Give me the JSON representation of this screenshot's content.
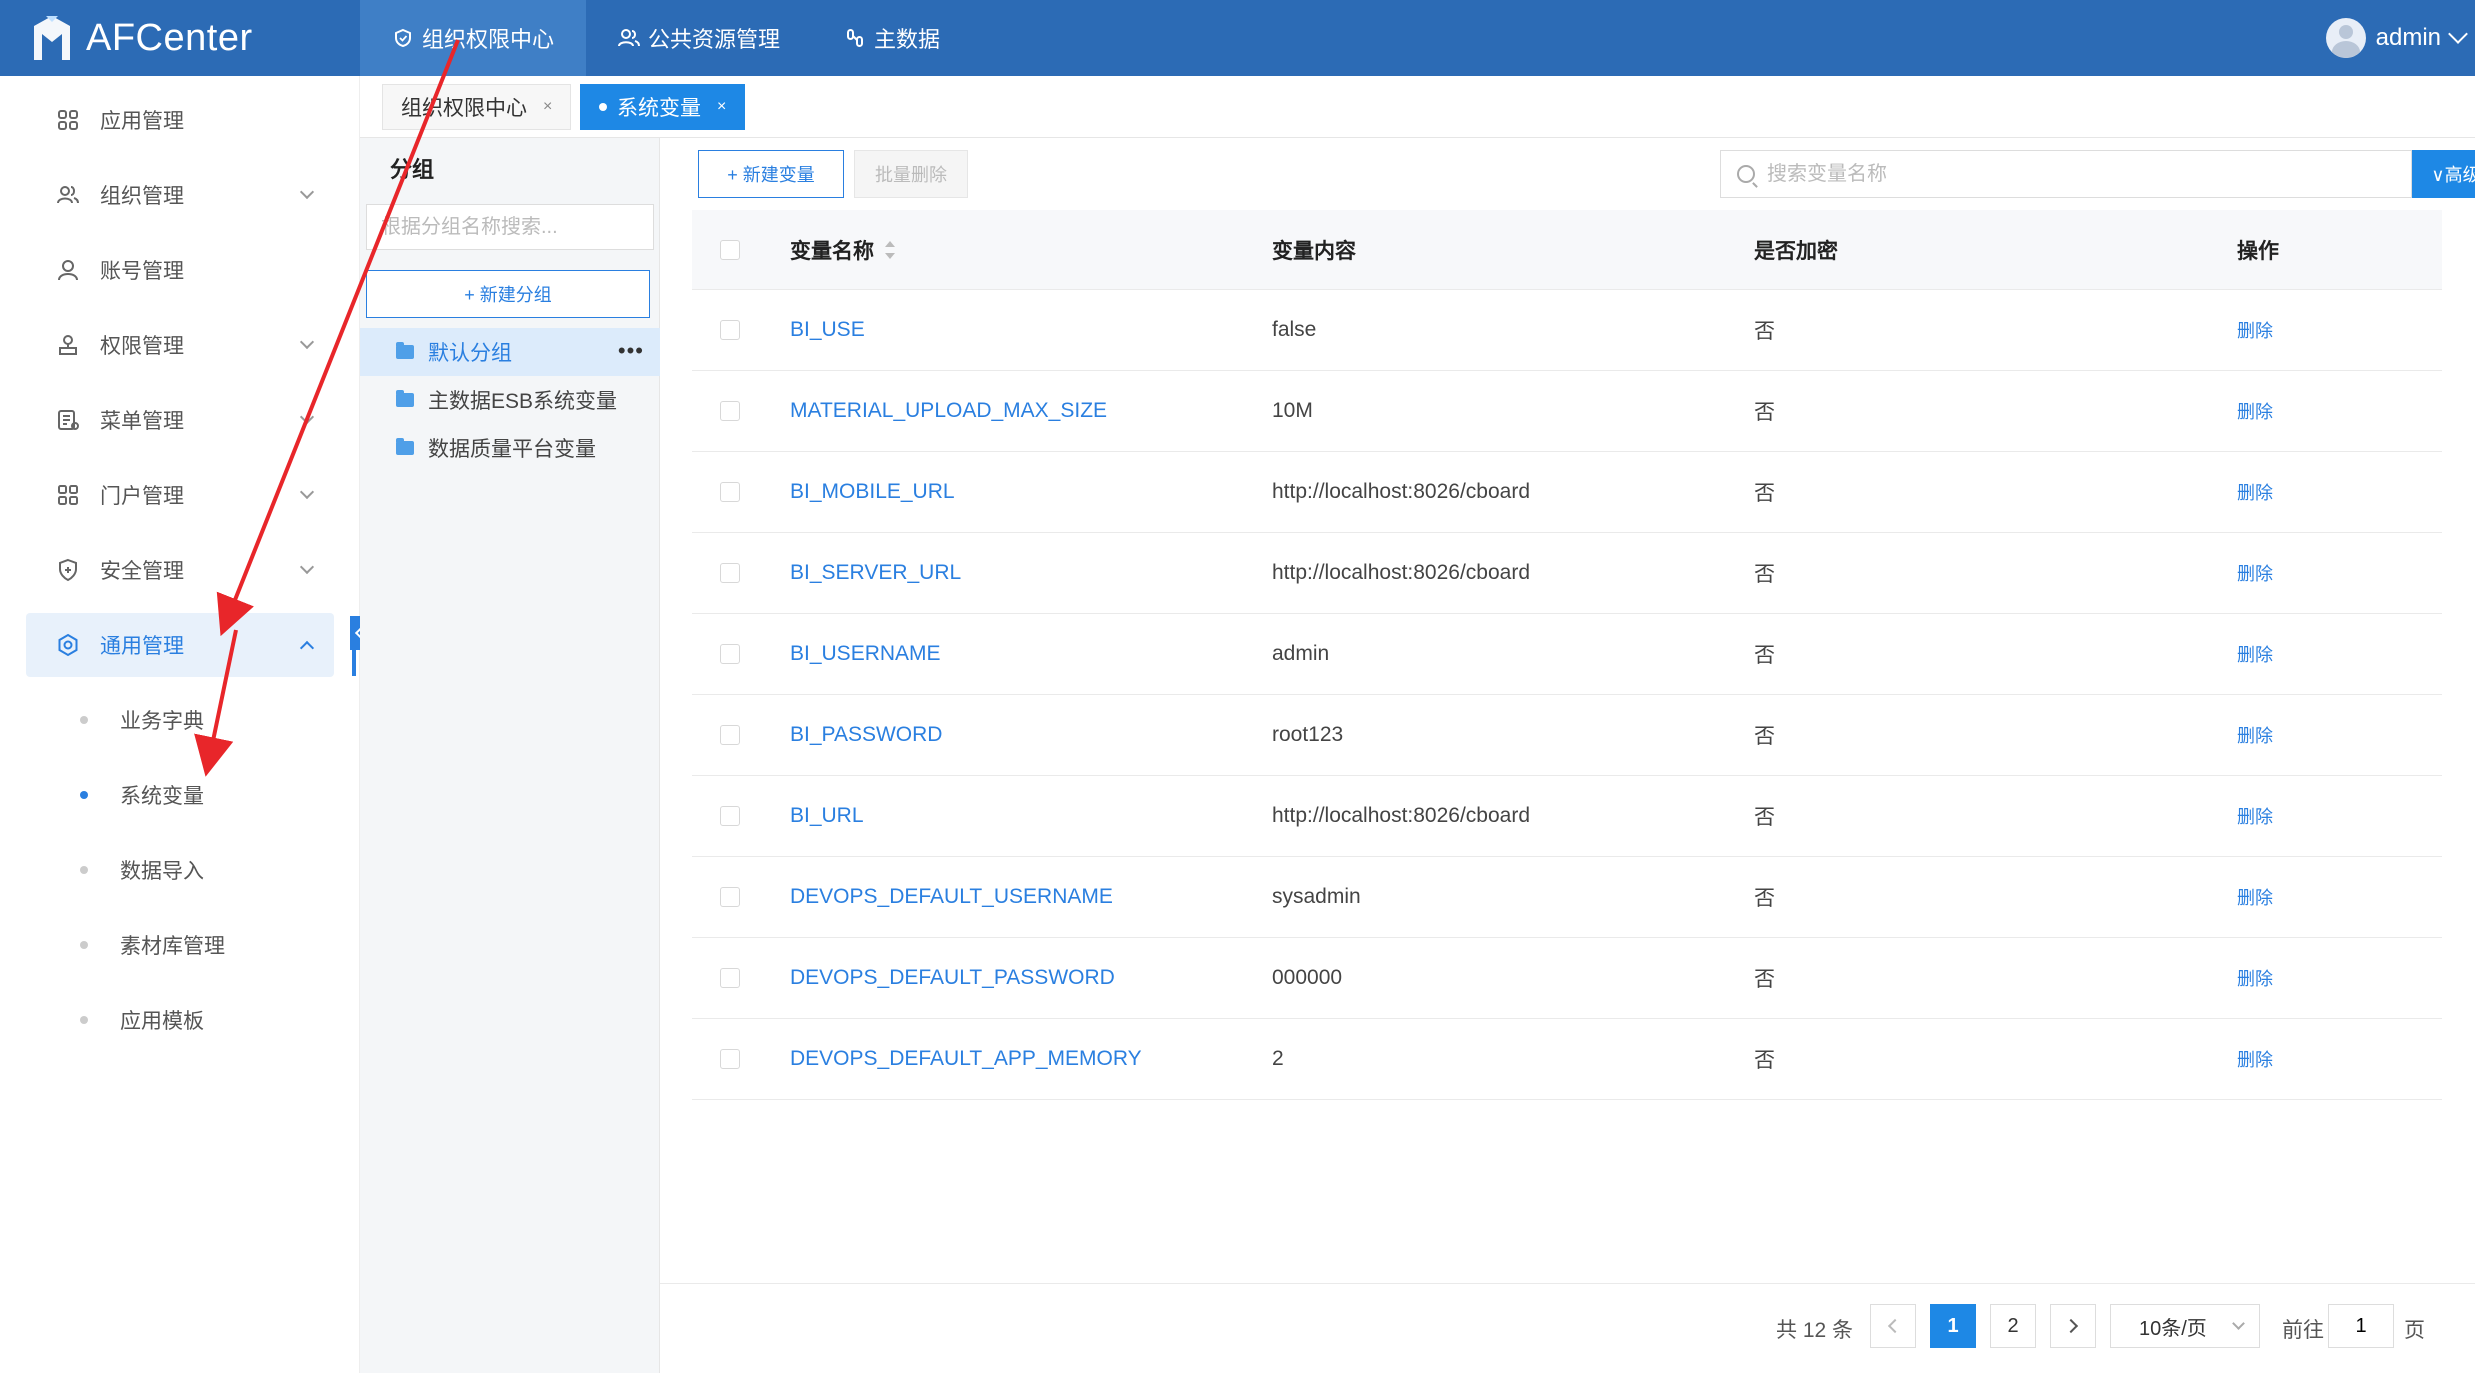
{
  "app": {
    "title": "AFCenter"
  },
  "topnav": [
    {
      "label": "组织权限中心",
      "icon": "shield-icon",
      "active": true
    },
    {
      "label": "公共资源管理",
      "icon": "users-icon",
      "active": false
    },
    {
      "label": "主数据",
      "icon": "link-icon",
      "active": false
    }
  ],
  "user": {
    "name": "admin"
  },
  "sidebar": {
    "items": [
      {
        "label": "应用管理",
        "icon": "grid-icon"
      },
      {
        "label": "组织管理",
        "icon": "team-icon"
      },
      {
        "label": "账号管理",
        "icon": "user-icon"
      },
      {
        "label": "权限管理",
        "icon": "permission-icon"
      },
      {
        "label": "菜单管理",
        "icon": "menu-icon"
      },
      {
        "label": "门户管理",
        "icon": "portal-icon"
      },
      {
        "label": "安全管理",
        "icon": "security-icon"
      },
      {
        "label": "通用管理",
        "icon": "settings-icon"
      }
    ],
    "sub_items": [
      {
        "label": "业务字典"
      },
      {
        "label": "系统变量"
      },
      {
        "label": "数据导入"
      },
      {
        "label": "素材库管理"
      },
      {
        "label": "应用模板"
      }
    ]
  },
  "tabs": [
    {
      "label": "组织权限中心",
      "close": "×"
    },
    {
      "label": "系统变量",
      "close": "×"
    }
  ],
  "groups": {
    "title": "分组",
    "search_placeholder": "根据分组名称搜索...",
    "new_button": "+ 新建分组",
    "items": [
      {
        "label": "默认分组",
        "more": "•••"
      },
      {
        "label": "主数据ESB系统变量"
      },
      {
        "label": "数据质量平台变量"
      }
    ]
  },
  "toolbar": {
    "new_label": "+ 新建变量",
    "batch_delete_label": "批量删除",
    "search_placeholder": "搜索变量名称",
    "advanced_label": "∨高级"
  },
  "table": {
    "headers": {
      "name": "变量名称",
      "content": "变量内容",
      "encrypted": "是否加密",
      "action": "操作"
    },
    "rows": [
      {
        "name": "BI_USE",
        "content": "false",
        "encrypted": "否",
        "action": "删除"
      },
      {
        "name": "MATERIAL_UPLOAD_MAX_SIZE",
        "content": "10M",
        "encrypted": "否",
        "action": "删除"
      },
      {
        "name": "BI_MOBILE_URL",
        "content": "http://localhost:8026/cboard",
        "encrypted": "否",
        "action": "删除"
      },
      {
        "name": "BI_SERVER_URL",
        "content": "http://localhost:8026/cboard",
        "encrypted": "否",
        "action": "删除"
      },
      {
        "name": "BI_USERNAME",
        "content": "admin",
        "encrypted": "否",
        "action": "删除"
      },
      {
        "name": "BI_PASSWORD",
        "content": "root123",
        "encrypted": "否",
        "action": "删除"
      },
      {
        "name": "BI_URL",
        "content": "http://localhost:8026/cboard",
        "encrypted": "否",
        "action": "删除"
      },
      {
        "name": "DEVOPS_DEFAULT_USERNAME",
        "content": "sysadmin",
        "encrypted": "否",
        "action": "删除"
      },
      {
        "name": "DEVOPS_DEFAULT_PASSWORD",
        "content": "000000",
        "encrypted": "否",
        "action": "删除"
      },
      {
        "name": "DEVOPS_DEFAULT_APP_MEMORY",
        "content": "2",
        "encrypted": "否",
        "action": "删除"
      }
    ]
  },
  "pagination": {
    "total": "共 12 条",
    "pages": [
      "1",
      "2"
    ],
    "page_size": "10条/页",
    "goto_label": "前往",
    "goto_value": "1",
    "page_label": "页"
  },
  "colors": {
    "header": "#2c6bb5",
    "accent": "#1e88e5",
    "annotation": "#e8262a"
  }
}
